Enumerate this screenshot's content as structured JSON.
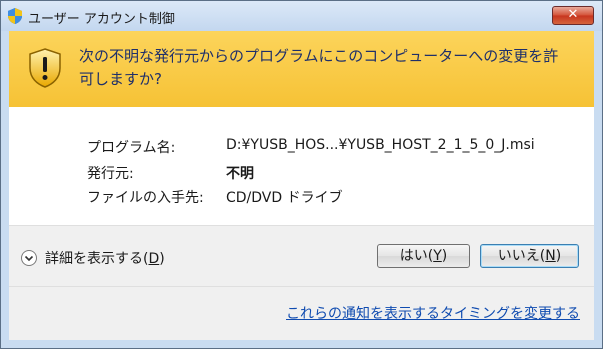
{
  "window": {
    "title": "ユーザー アカウント制御",
    "close_label": "✕",
    "accent_color": "#f6c235"
  },
  "banner": {
    "line1": "次の不明な発行元からのプログラムにこのコンピューターへの変更を許",
    "line2": "可しますか?"
  },
  "info": {
    "program_label": "プログラム名:",
    "program_value": "D:¥YUSB_HOS...¥YUSB_HOST_2_1_5_0_J.msi",
    "publisher_label": "発行元:",
    "publisher_value": "不明",
    "source_label": "ファイルの入手先:",
    "source_value": "CD/DVD ドライブ"
  },
  "details": {
    "label": "詳細を表示する(",
    "key": "D",
    "suffix": ")"
  },
  "buttons": {
    "yes_label": "はい(",
    "yes_key": "Y",
    "yes_suffix": ")",
    "no_label": "いいえ(",
    "no_key": "N",
    "no_suffix": ")"
  },
  "footer": {
    "link": "これらの通知を表示するタイミングを変更する"
  }
}
